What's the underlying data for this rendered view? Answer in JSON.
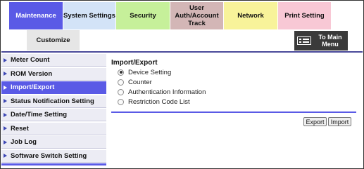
{
  "tabs": [
    {
      "label": "Maintenance",
      "color": "#5a5ae6",
      "active": true
    },
    {
      "label": "System Settings",
      "color": "#d3e3f7",
      "active": false
    },
    {
      "label": "Security",
      "color": "#c6f09a",
      "active": false
    },
    {
      "label": "User Auth/Account Track",
      "color": "#d3b6b6",
      "active": false
    },
    {
      "label": "Network",
      "color": "#f8f39a",
      "active": false
    },
    {
      "label": "Print Setting",
      "color": "#f8c8d5",
      "active": false
    }
  ],
  "sub_tab": {
    "label": "Customize",
    "color": "#e6e6e6"
  },
  "main_menu": {
    "label": "To Main Menu",
    "icon": "main-menu-icon"
  },
  "sidebar": {
    "items": [
      {
        "label": "Meter Count",
        "active": false
      },
      {
        "label": "ROM Version",
        "active": false
      },
      {
        "label": "Import/Export",
        "active": true
      },
      {
        "label": "Status Notification Setting",
        "active": false
      },
      {
        "label": "Date/Time Setting",
        "active": false
      },
      {
        "label": "Reset",
        "active": false
      },
      {
        "label": "Job Log",
        "active": false
      },
      {
        "label": "Software Switch Setting",
        "active": false
      }
    ]
  },
  "content": {
    "title": "Import/Export",
    "options": [
      {
        "label": "Device Setting",
        "checked": true
      },
      {
        "label": "Counter",
        "checked": false
      },
      {
        "label": "Authentication Information",
        "checked": false
      },
      {
        "label": "Restriction Code List",
        "checked": false
      }
    ],
    "export_label": "Export",
    "import_label": "Import"
  },
  "colors": {
    "accent": "#5a5ae6",
    "sidebar_bg": "#ececf4",
    "menu_button": "#3a3a3a"
  }
}
